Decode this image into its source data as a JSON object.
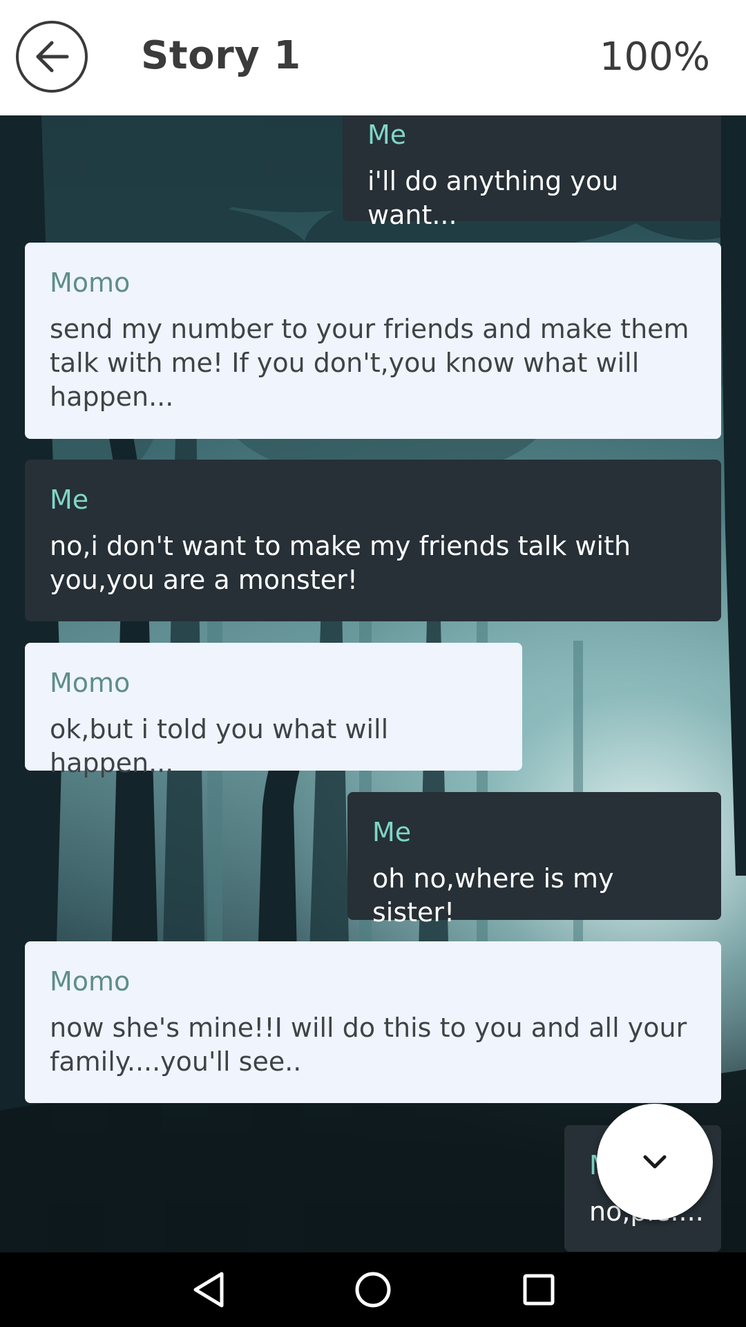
{
  "header": {
    "title": "Story 1",
    "progress": "100%"
  },
  "messages": [
    {
      "sender": "Me",
      "text": "i'll do anything you want..."
    },
    {
      "sender": "Momo",
      "text": "send my number to your friends and make them talk with me! If you don't,you know what will happen..."
    },
    {
      "sender": "Me",
      "text": "no,i don't want to make my friends talk with you,you are a monster!"
    },
    {
      "sender": "Momo",
      "text": "ok,but i told you what will happen..."
    },
    {
      "sender": "Me",
      "text": "oh no,where is my sister!"
    },
    {
      "sender": "Momo",
      "text": "now she's mine!!I will do this to you and all your family....you'll see.."
    },
    {
      "sender": "Me",
      "text": "no,ple...."
    }
  ],
  "icons": {
    "back": "arrow-left-circle",
    "fab": "chevron-down",
    "nav_back": "triangle-left",
    "nav_home": "circle",
    "nav_recents": "square"
  },
  "colors": {
    "me_bubble": "#263036",
    "me_sender": "#80d6c7",
    "momo_bubble": "#eff4fd",
    "momo_sender": "#5f8d88"
  }
}
